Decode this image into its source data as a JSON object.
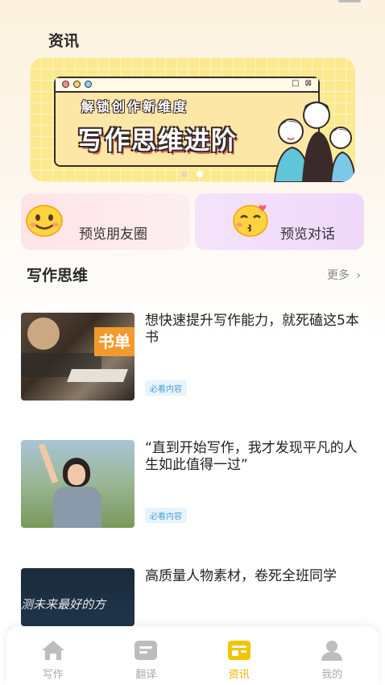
{
  "page": {
    "title": "资讯"
  },
  "banner": {
    "subtitle": "解锁创作新维度",
    "title": "写作思维进阶",
    "window_buttons": "□ ⊠",
    "active_slide": 2,
    "slide_count": 2
  },
  "preview_cards": [
    {
      "label": "预览朋友圈",
      "icon": "smiling-emoji-icon"
    },
    {
      "label": "预览对话",
      "icon": "kissing-emoji-icon"
    }
  ],
  "section": {
    "title": "写作思维",
    "more_label": "更多",
    "more_icon": "chevron-right-icon"
  },
  "articles": [
    {
      "title": "想快速提升写作能力，就死磕这5本书",
      "tag": "必看内容",
      "thumb_text": "书单"
    },
    {
      "title": "“直到开始写作，我才发现平凡的人生如此值得一过”",
      "tag": "必看内容"
    },
    {
      "title": "高质量人物素材，卷死全班同学",
      "thumb_text": "测未来最好的方"
    }
  ],
  "tabbar": {
    "items": [
      {
        "label": "写作",
        "icon": "home-icon",
        "active": false
      },
      {
        "label": "翻译",
        "icon": "translate-icon",
        "active": false
      },
      {
        "label": "资讯",
        "icon": "news-icon",
        "active": true
      },
      {
        "label": "我的",
        "icon": "profile-icon",
        "active": false
      }
    ]
  },
  "colors": {
    "accent": "#e9b400",
    "banner_bg": "#fbe98e",
    "tag_text": "#4a9fd8",
    "inactive": "#aaaaaa"
  }
}
